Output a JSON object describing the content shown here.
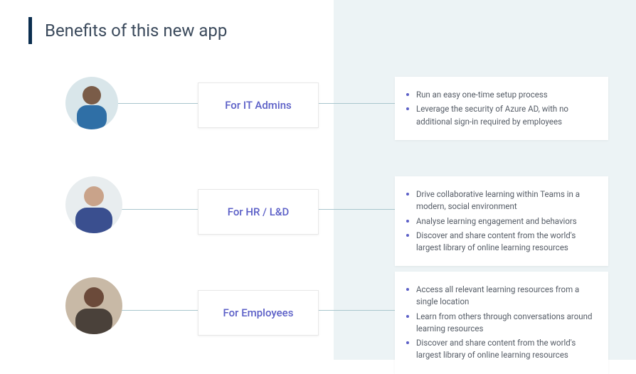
{
  "title": "Benefits of this new app",
  "roles": [
    {
      "label": "For IT Admins",
      "bullets": [
        "Run an easy one-time setup process",
        "Leverage the security of Azure AD, with no additional sign-in required by employees"
      ]
    },
    {
      "label": "For HR / L&D",
      "bullets": [
        "Drive collaborative learning within Teams in a modern, social environment",
        "Analyse learning engagement and behaviors",
        "Discover and share content from the world's largest library of online learning resources"
      ]
    },
    {
      "label": "For Employees",
      "bullets": [
        "Access all relevant learning resources from a single location",
        "Learn from others through conversations around learning resources",
        "Discover and share content from the world's largest library of online learning resources"
      ]
    }
  ]
}
